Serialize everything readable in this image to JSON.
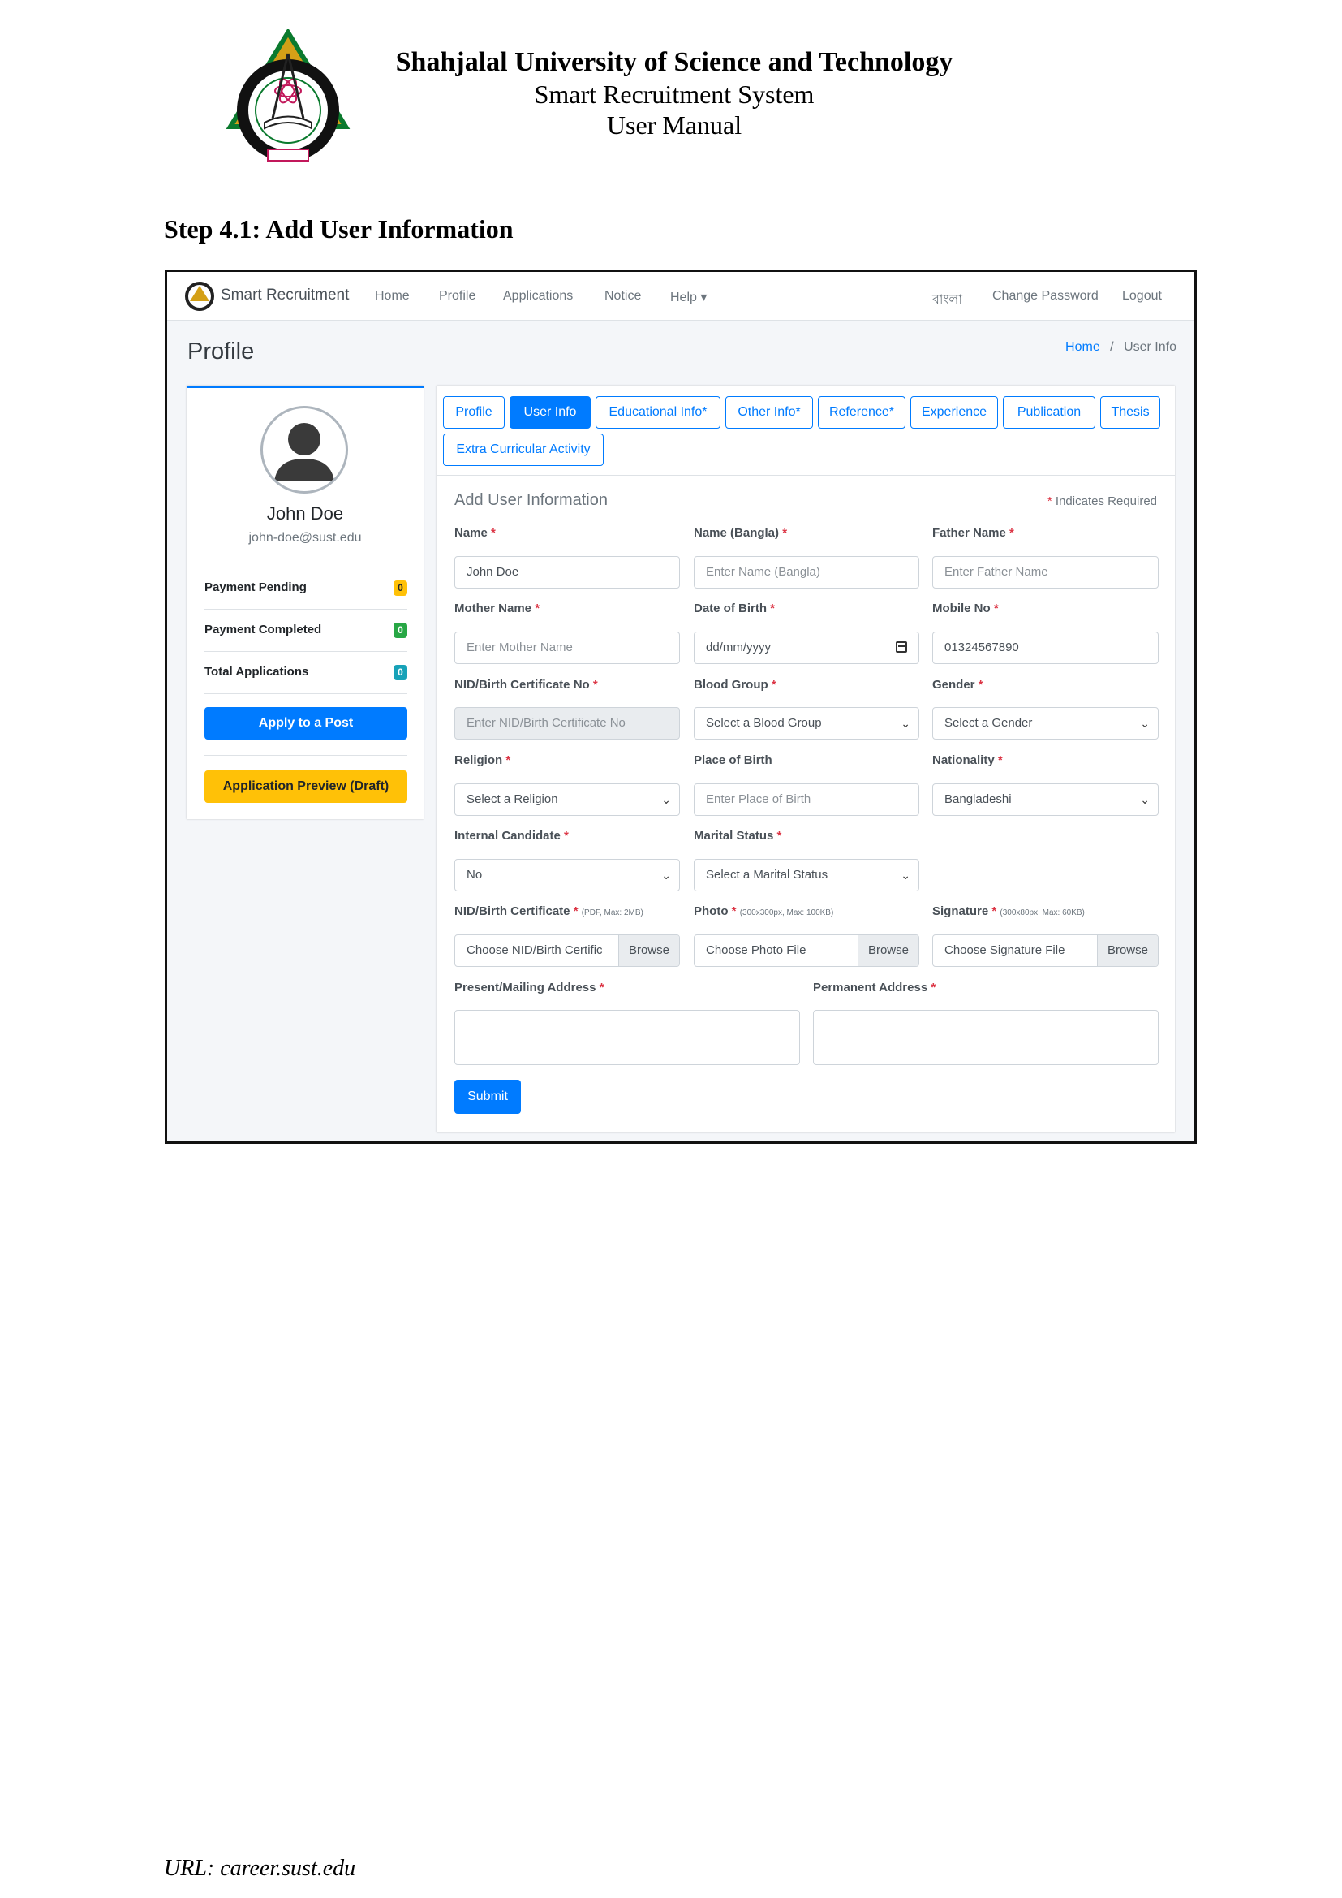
{
  "doc": {
    "title_line1": "Shahjalal University of Science and Technology",
    "title_line2": "Smart Recruitment System",
    "title_line3": "User Manual",
    "step_heading": "Step 4.1: Add User Information",
    "footer_url": "URL: career.sust.edu"
  },
  "colors": {
    "primary": "#007bff",
    "warning": "#ffc107",
    "success": "#28a745",
    "info": "#17a2b8",
    "required": "#dc3545"
  },
  "navbar": {
    "brand": "Smart Recruitment",
    "links": [
      "Home",
      "Profile",
      "Applications",
      "Notice",
      "Help ▾"
    ],
    "right_links": [
      "বাংলা",
      "Change Password",
      "Logout"
    ]
  },
  "page": {
    "title": "Profile",
    "breadcrumb_home": "Home",
    "breadcrumb_sep": "/",
    "breadcrumb_current": "User Info"
  },
  "profile_card": {
    "name": "John Doe",
    "email": "john-doe@sust.edu",
    "stats": [
      {
        "label": "Payment Pending",
        "count": "0",
        "color": "#ffc107"
      },
      {
        "label": "Payment Completed",
        "count": "0",
        "color": "#28a745"
      },
      {
        "label": "Total Applications",
        "count": "0",
        "color": "#17a2b8"
      }
    ],
    "apply_button": "Apply to a Post",
    "preview_button": "Application Preview (Draft)"
  },
  "tabs": [
    "Profile",
    "User Info",
    "Educational Info*",
    "Other Info*",
    "Reference*",
    "Experience",
    "Publication",
    "Thesis",
    "Extra Curricular Activity"
  ],
  "form": {
    "title": "Add User Information",
    "required_note": "Indicates Required",
    "required_mark": "*",
    "fields": {
      "name": {
        "label": "Name",
        "value": "John Doe"
      },
      "name_bangla": {
        "label": "Name (Bangla)",
        "placeholder": "Enter Name (Bangla)"
      },
      "father_name": {
        "label": "Father Name",
        "placeholder": "Enter Father Name"
      },
      "mother_name": {
        "label": "Mother Name",
        "placeholder": "Enter Mother Name"
      },
      "dob": {
        "label": "Date of Birth",
        "placeholder": "dd/mm/yyyy"
      },
      "mobile": {
        "label": "Mobile No",
        "value": "01324567890"
      },
      "nid": {
        "label": "NID/Birth Certificate No",
        "placeholder": "Enter NID/Birth Certificate No"
      },
      "blood_group": {
        "label": "Blood Group",
        "selected": "Select a Blood Group"
      },
      "gender": {
        "label": "Gender",
        "selected": "Select a Gender"
      },
      "religion": {
        "label": "Religion",
        "selected": "Select a Religion"
      },
      "place_of_birth": {
        "label": "Place of Birth",
        "placeholder": "Enter Place of Birth"
      },
      "nationality": {
        "label": "Nationality",
        "selected": "Bangladeshi"
      },
      "internal_candidate": {
        "label": "Internal Candidate",
        "selected": "No"
      },
      "marital_status": {
        "label": "Marital Status",
        "selected": "Select a Marital Status"
      },
      "nid_file": {
        "label": "NID/Birth Certificate",
        "hint": "(PDF, Max: 2MB)",
        "placeholder": "Choose NID/Birth Certific",
        "browse": "Browse"
      },
      "photo_file": {
        "label": "Photo",
        "hint": "(300x300px, Max: 100KB)",
        "placeholder": "Choose Photo File",
        "browse": "Browse"
      },
      "signature_file": {
        "label": "Signature",
        "hint": "(300x80px, Max: 60KB)",
        "placeholder": "Choose Signature File",
        "browse": "Browse"
      },
      "present_address": {
        "label": "Present/Mailing Address"
      },
      "permanent_address": {
        "label": "Permanent Address"
      }
    },
    "submit": "Submit"
  }
}
